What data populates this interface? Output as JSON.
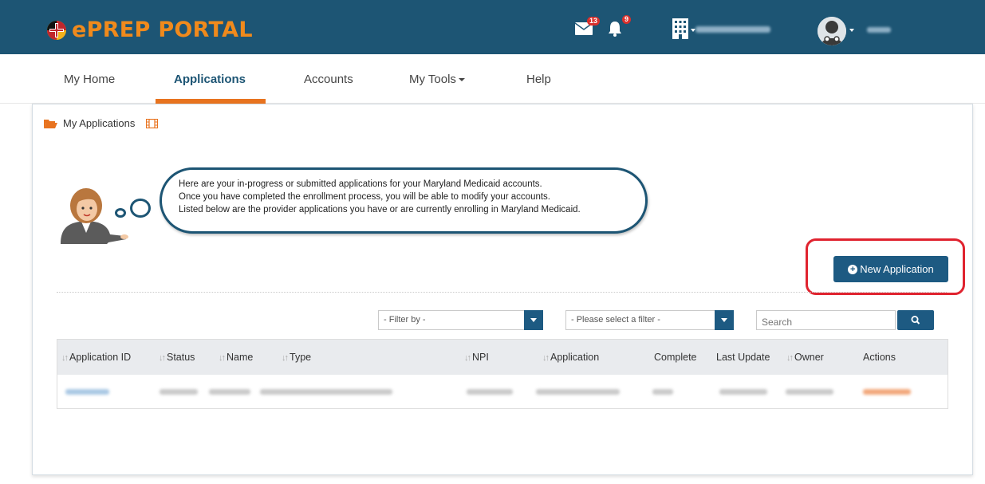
{
  "header": {
    "logo_text": "ePREP PORTAL",
    "mail_count": "13",
    "notification_count": "9"
  },
  "nav": {
    "items": [
      {
        "label": "My Home"
      },
      {
        "label": "Applications"
      },
      {
        "label": "Accounts"
      },
      {
        "label": "My Tools"
      },
      {
        "label": "Help"
      }
    ],
    "active": "Applications"
  },
  "breadcrumb": {
    "label": "My Applications"
  },
  "bubble": {
    "line1": "Here are your in-progress or submitted applications for your Maryland Medicaid accounts.",
    "line2": "Once you have completed the enrollment process, you will be able to modify your accounts.",
    "line3": "Listed below are the provider applications you have or are currently enrolling in Maryland Medicaid."
  },
  "actions": {
    "new_application": "New Application"
  },
  "filters": {
    "filter_by": "- Filter by -",
    "select_filter": "- Please select a filter -",
    "search_placeholder": "Search"
  },
  "table": {
    "columns": [
      "Application ID",
      "Status",
      "Name",
      "Type",
      "NPI",
      "Application",
      "Complete",
      "Last Update",
      "Owner",
      "Actions"
    ],
    "rows": 1
  },
  "colors": {
    "brand_blue": "#1d5574",
    "accent_orange": "#e8731f",
    "highlight_red": "#e0232f"
  }
}
